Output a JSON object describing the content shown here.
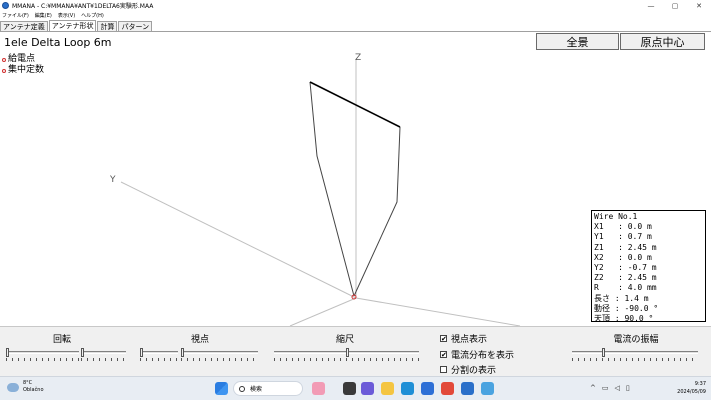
{
  "window": {
    "title": "MMANA - C:¥MMANA¥ANT¥1DELTA6実験形.MAA"
  },
  "menu": [
    "ファイル(F)",
    "編集(E)",
    "表示(V)",
    "ヘルプ(H)"
  ],
  "tabs": [
    {
      "label": "アンテナ定義"
    },
    {
      "label": "アンテナ形状",
      "active": true
    },
    {
      "label": "計算"
    },
    {
      "label": "パターン"
    }
  ],
  "header": {
    "title": "1ele Delta Loop 6m",
    "overview_button": "全景",
    "origin_center_button": "原点中心"
  },
  "legend": {
    "feed_point": "給電点",
    "lumped_constant": "集中定数"
  },
  "axes": {
    "z": "Z",
    "y": "Y"
  },
  "wire_info": {
    "lines": [
      "Wire No.1",
      "X1   : 0.0 m",
      "Y1   : 0.7 m",
      "Z1   : 2.45 m",
      "X2   : 0.0 m",
      "Y2   : -0.7 m",
      "Z2   : 2.45 m",
      "R    : 4.0 mm",
      "長さ : 1.4 m",
      "動径 : -90.0 °",
      "天頂 : 90.0 °"
    ]
  },
  "controls": {
    "rotation_label": "回転",
    "viewpoint_label": "視点",
    "scale_label": "縮尺",
    "current_amplitude_label": "電流の振幅",
    "show_viewpoint": {
      "label": "視点表示",
      "checked": true
    },
    "show_current_distribution": {
      "label": "電流分布を表示",
      "checked": true
    },
    "show_segments": {
      "label": "分割の表示",
      "checked": false
    }
  },
  "taskbar": {
    "weather_temp": "8°C",
    "weather_desc": "Oblačno",
    "search_placeholder": "検索",
    "time": "9:37",
    "date": "2024/05/09"
  },
  "colors": {
    "feed_marker": "#d03030",
    "axis": "#c0c0c0",
    "selected_wire": "#000000",
    "wire": "#444444"
  }
}
